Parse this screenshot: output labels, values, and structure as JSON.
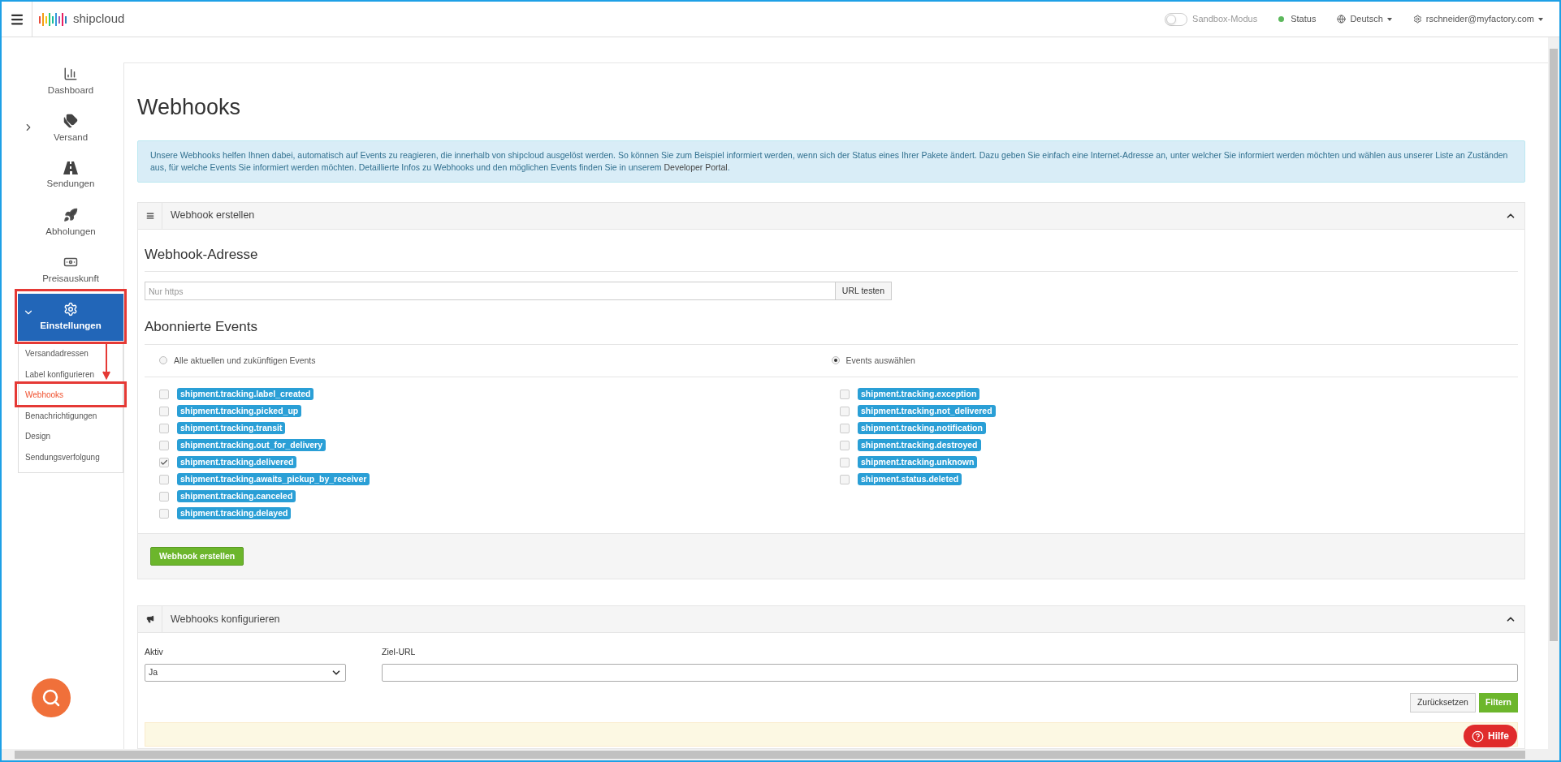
{
  "topbar": {
    "logo": "shipcloud",
    "sandbox": {
      "label": "Sandbox-Modus",
      "on": false
    },
    "status": {
      "label": "Status",
      "color": "#5cb85c"
    },
    "language": "Deutsch",
    "user": "rschneider@myfactory.com"
  },
  "sidebar": {
    "items": [
      {
        "kind": "chart",
        "label": "Dashboard",
        "selected": false
      },
      {
        "kind": "tags",
        "label": "Versand",
        "expanded": false,
        "selected": false
      },
      {
        "kind": "road",
        "label": "Sendungen",
        "selected": false
      },
      {
        "kind": "rocket",
        "label": "Abholungen",
        "selected": false
      },
      {
        "kind": "money",
        "label": "Preisauskunft",
        "selected": false
      },
      {
        "kind": "gear",
        "label": "Einstellungen",
        "expanded": true,
        "selected": true,
        "children": [
          {
            "label": "Versandadressen",
            "selected": false
          },
          {
            "label": "Label konfigurieren",
            "selected": false
          },
          {
            "label": "Webhooks",
            "selected": true
          },
          {
            "label": "Benachrichtigungen",
            "selected": false
          },
          {
            "label": "Design",
            "selected": false
          },
          {
            "label": "Sendungsverfolgung",
            "selected": false
          }
        ]
      }
    ]
  },
  "page_title": "Webhooks",
  "info": {
    "text": "Unsere Webhooks helfen Ihnen dabei, automatisch auf Events zu reagieren, die innerhalb von shipcloud ausgelöst werden. So können Sie zum Beispiel informiert werden, wenn sich der Status eines Ihrer Pakete ändert. Dazu geben Sie einfach eine Internet-Adresse an, unter welcher Sie informiert werden möchten und wählen aus unserer Liste an Zuständen aus, für welche Events Sie informiert werden möchten. Detaillierte Infos zu Webhooks und den möglichen Events finden Sie in unserem",
    "link": "Developer Portal",
    "end": "."
  },
  "create_panel": {
    "title": "Webhook erstellen",
    "expanded": true,
    "address_heading": "Webhook-Adresse",
    "address_placeholder": "Nur https",
    "test_button": "URL testen",
    "events_heading": "Abonnierte Events",
    "modes": [
      {
        "label": "Alle aktuellen und zukünftigen Events",
        "selected": false
      },
      {
        "label": "Events auswählen",
        "selected": true
      }
    ],
    "events_left": [
      {
        "label": "shipment.tracking.label_created",
        "checked": false
      },
      {
        "label": "shipment.tracking.picked_up",
        "checked": false
      },
      {
        "label": "shipment.tracking.transit",
        "checked": false
      },
      {
        "label": "shipment.tracking.out_for_delivery",
        "checked": false
      },
      {
        "label": "shipment.tracking.delivered",
        "checked": true
      },
      {
        "label": "shipment.tracking.awaits_pickup_by_receiver",
        "checked": false
      },
      {
        "label": "shipment.tracking.canceled",
        "checked": false
      },
      {
        "label": "shipment.tracking.delayed",
        "checked": false
      }
    ],
    "events_right": [
      {
        "label": "shipment.tracking.exception",
        "checked": false
      },
      {
        "label": "shipment.tracking.not_delivered",
        "checked": false
      },
      {
        "label": "shipment.tracking.notification",
        "checked": false
      },
      {
        "label": "shipment.tracking.destroyed",
        "checked": false
      },
      {
        "label": "shipment.tracking.unknown",
        "checked": false
      },
      {
        "label": "shipment.status.deleted",
        "checked": false
      }
    ],
    "submit": "Webhook erstellen"
  },
  "config_panel": {
    "title": "Webhooks konfigurieren",
    "expanded": true,
    "active_label": "Aktiv",
    "active_value": "Ja",
    "url_label": "Ziel-URL",
    "reset": "Zurücksetzen",
    "filter": "Filtern"
  },
  "help_button": "Hilfe"
}
